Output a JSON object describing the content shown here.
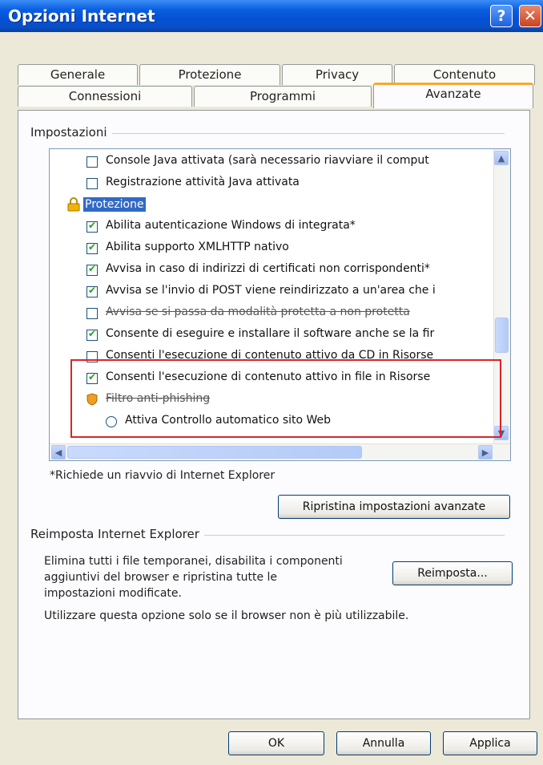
{
  "window": {
    "title": "Opzioni Internet",
    "help_glyph": "?",
    "close_glyph": "✕"
  },
  "tabs": {
    "row1": [
      "Generale",
      "Protezione",
      "Privacy",
      "Contenuto"
    ],
    "row2": [
      "Connessioni",
      "Programmi",
      "Avanzate"
    ],
    "active": "Avanzate"
  },
  "settings": {
    "group_label": "Impostazioni",
    "items": [
      {
        "label": "Console Java attivata (sarà necessario riavviare il comput",
        "control": "checkbox",
        "checked": false
      },
      {
        "label": "Registrazione attività Java attivata",
        "control": "checkbox",
        "checked": false
      },
      {
        "label": "Protezione",
        "control": "category",
        "icon": "lock-icon"
      },
      {
        "label": "Abilita autenticazione Windows di integrata*",
        "control": "checkbox",
        "checked": true
      },
      {
        "label": "Abilita supporto XMLHTTP nativo",
        "control": "checkbox",
        "checked": true
      },
      {
        "label": "Avvisa in caso di indirizzi di certificati non corrispondenti*",
        "control": "checkbox",
        "checked": true
      },
      {
        "label": "Avvisa se l'invio di POST viene reindirizzato a un'area che i",
        "control": "checkbox",
        "checked": true
      },
      {
        "label": "Avvisa se si passa da modalità protetta a non protetta",
        "control": "checkbox",
        "checked": false
      },
      {
        "label": "Consente di eseguire e installare il software anche se la fir",
        "control": "checkbox",
        "checked": true
      },
      {
        "label": "Consenti l'esecuzione di contenuto attivo da CD in Risorse",
        "control": "checkbox",
        "checked": false
      },
      {
        "label": "Consenti l'esecuzione di contenuto attivo in file in Risorse",
        "control": "checkbox",
        "checked": true
      },
      {
        "label": "Filtro anti-phishing",
        "control": "category",
        "icon": "shield-warning-icon"
      },
      {
        "label": "Attiva Controllo automatico sito Web",
        "control": "radio",
        "checked": false
      }
    ],
    "highlight_color": "#d9242a"
  },
  "restart_note": "*Richiede un riavvio di Internet Explorer",
  "restore_button": "Ripristina impostazioni avanzate",
  "reset": {
    "group_label": "Reimposta Internet Explorer",
    "description": [
      "Elimina tutti i file temporanei, disabilita i componenti",
      "aggiuntivi del browser e ripristina tutte le",
      "impostazioni modificate."
    ],
    "note": "Utilizzare questa opzione solo se il browser non è più utilizzabile.",
    "button": "Reimposta..."
  },
  "footer": {
    "ok": "OK",
    "cancel": "Annulla",
    "apply": "Applica"
  }
}
